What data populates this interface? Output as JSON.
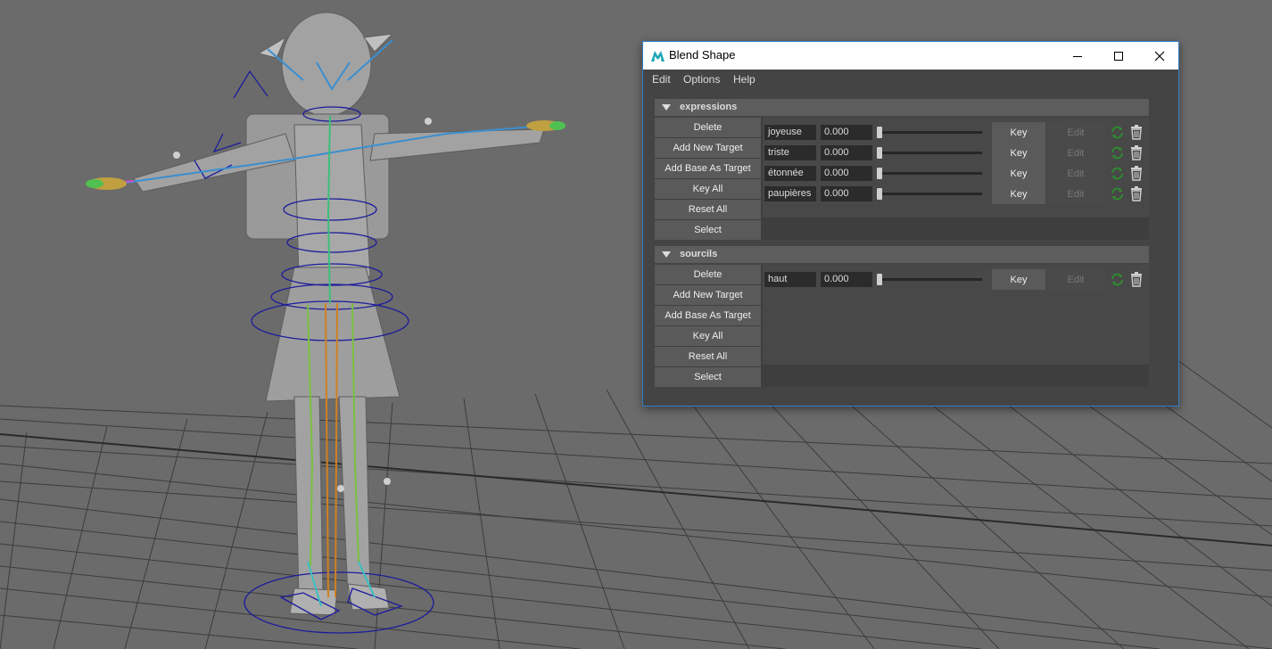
{
  "window": {
    "title": "Blend Shape",
    "accent": "#2f7fc9"
  },
  "menu": [
    "Edit",
    "Options",
    "Help"
  ],
  "icons": {
    "app": "maya-logo-icon",
    "minimize": "minimize-icon",
    "maximize": "maximize-icon",
    "close": "close-icon",
    "section_toggle": "triangle-down-icon",
    "swap": "swap-green-icon",
    "delete": "trash-icon"
  },
  "sections": [
    {
      "name": "expressions",
      "buttons": [
        "Delete",
        "Add New Target",
        "Add Base As Target",
        "Key All",
        "Reset All",
        "Select"
      ],
      "targets": [
        {
          "name": "joyeuse",
          "value": "0.000",
          "weight": 0,
          "key_label": "Key",
          "edit_label": "Edit"
        },
        {
          "name": "triste",
          "value": "0.000",
          "weight": 0,
          "key_label": "Key",
          "edit_label": "Edit"
        },
        {
          "name": "étonnée",
          "value": "0.000",
          "weight": 0,
          "key_label": "Key",
          "edit_label": "Edit"
        },
        {
          "name": "paupières",
          "value": "0.000",
          "weight": 0,
          "key_label": "Key",
          "edit_label": "Edit"
        }
      ]
    },
    {
      "name": "sourcils",
      "buttons": [
        "Delete",
        "Add New Target",
        "Add Base As Target",
        "Key All",
        "Reset All",
        "Select"
      ],
      "targets": [
        {
          "name": "haut",
          "value": "0.000",
          "weight": 0,
          "key_label": "Key",
          "edit_label": "Edit"
        }
      ]
    }
  ]
}
